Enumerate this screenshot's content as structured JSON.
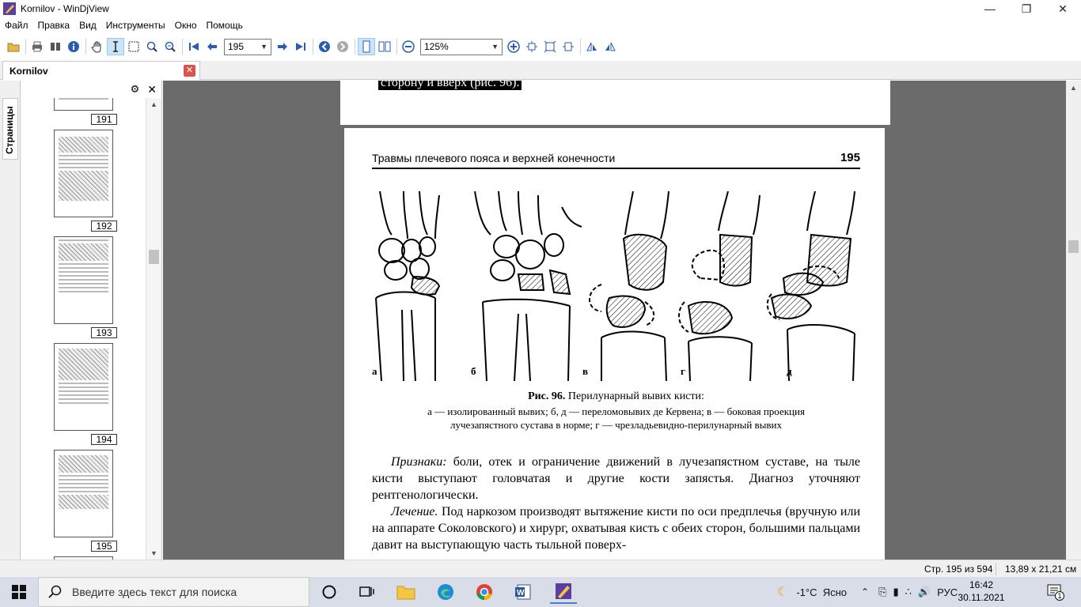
{
  "window": {
    "title": "Kornilov - WinDjView"
  },
  "menu": [
    "Файл",
    "Правка",
    "Вид",
    "Инструменты",
    "Окно",
    "Помощь"
  ],
  "toolbar": {
    "page_value": "195",
    "zoom_value": "125%"
  },
  "tab": {
    "label": "Kornilov"
  },
  "sidebar": {
    "vertical_tab": "Страницы",
    "thumbnails": [
      {
        "label": "191"
      },
      {
        "label": "192"
      },
      {
        "label": "193"
      },
      {
        "label": "194"
      },
      {
        "label": "195"
      }
    ]
  },
  "document": {
    "prev_page_text": "сторону и вверх (рис. 96).",
    "running_head": "Травмы плечевого пояса и верхней конечности",
    "page_number": "195",
    "figure_labels": [
      "а",
      "б",
      "в",
      "г",
      "д"
    ],
    "caption_title_bold": "Рис. 96.",
    "caption_title_rest": " Перилунарный вывих кисти:",
    "caption_line1": "а — изолированный вывих; б, д — переломовывих де Кервена; в — боковая проекция",
    "caption_line2": "лучезапястного сустава в норме; г — чрезладьевидно-перилунарный вывих",
    "para1_italic": "Признаки:",
    "para1_text": " боли, отек и ограничение движений в лучезапястном суставе, на тыле кисти выступают головчатая и другие кости запястья. Диагноз уточняют рентгенологически.",
    "para2_italic": "Лечение.",
    "para2_text": " Под наркозом производят вытяжение кисти по оси предплечья (вручную или на аппарате Соколовского) и хирург, охватывая кисть с обеих сторон, большими пальцами давит на выступающую часть тыльной поверх-"
  },
  "status": {
    "page_info": "Стр. 195 из 594",
    "page_size": "13,89 x 21,21 см"
  },
  "taskbar": {
    "search_placeholder": "Введите здесь текст для поиска",
    "weather": "-1°C  Ясно",
    "language": "РУС",
    "time": "16:42",
    "date": "30.11.2021",
    "notification_count": "1"
  },
  "colors": {
    "viewer_bg": "#6b6b6b",
    "taskbar_bg": "#d8dde8",
    "close_tab": "#d9534f"
  }
}
